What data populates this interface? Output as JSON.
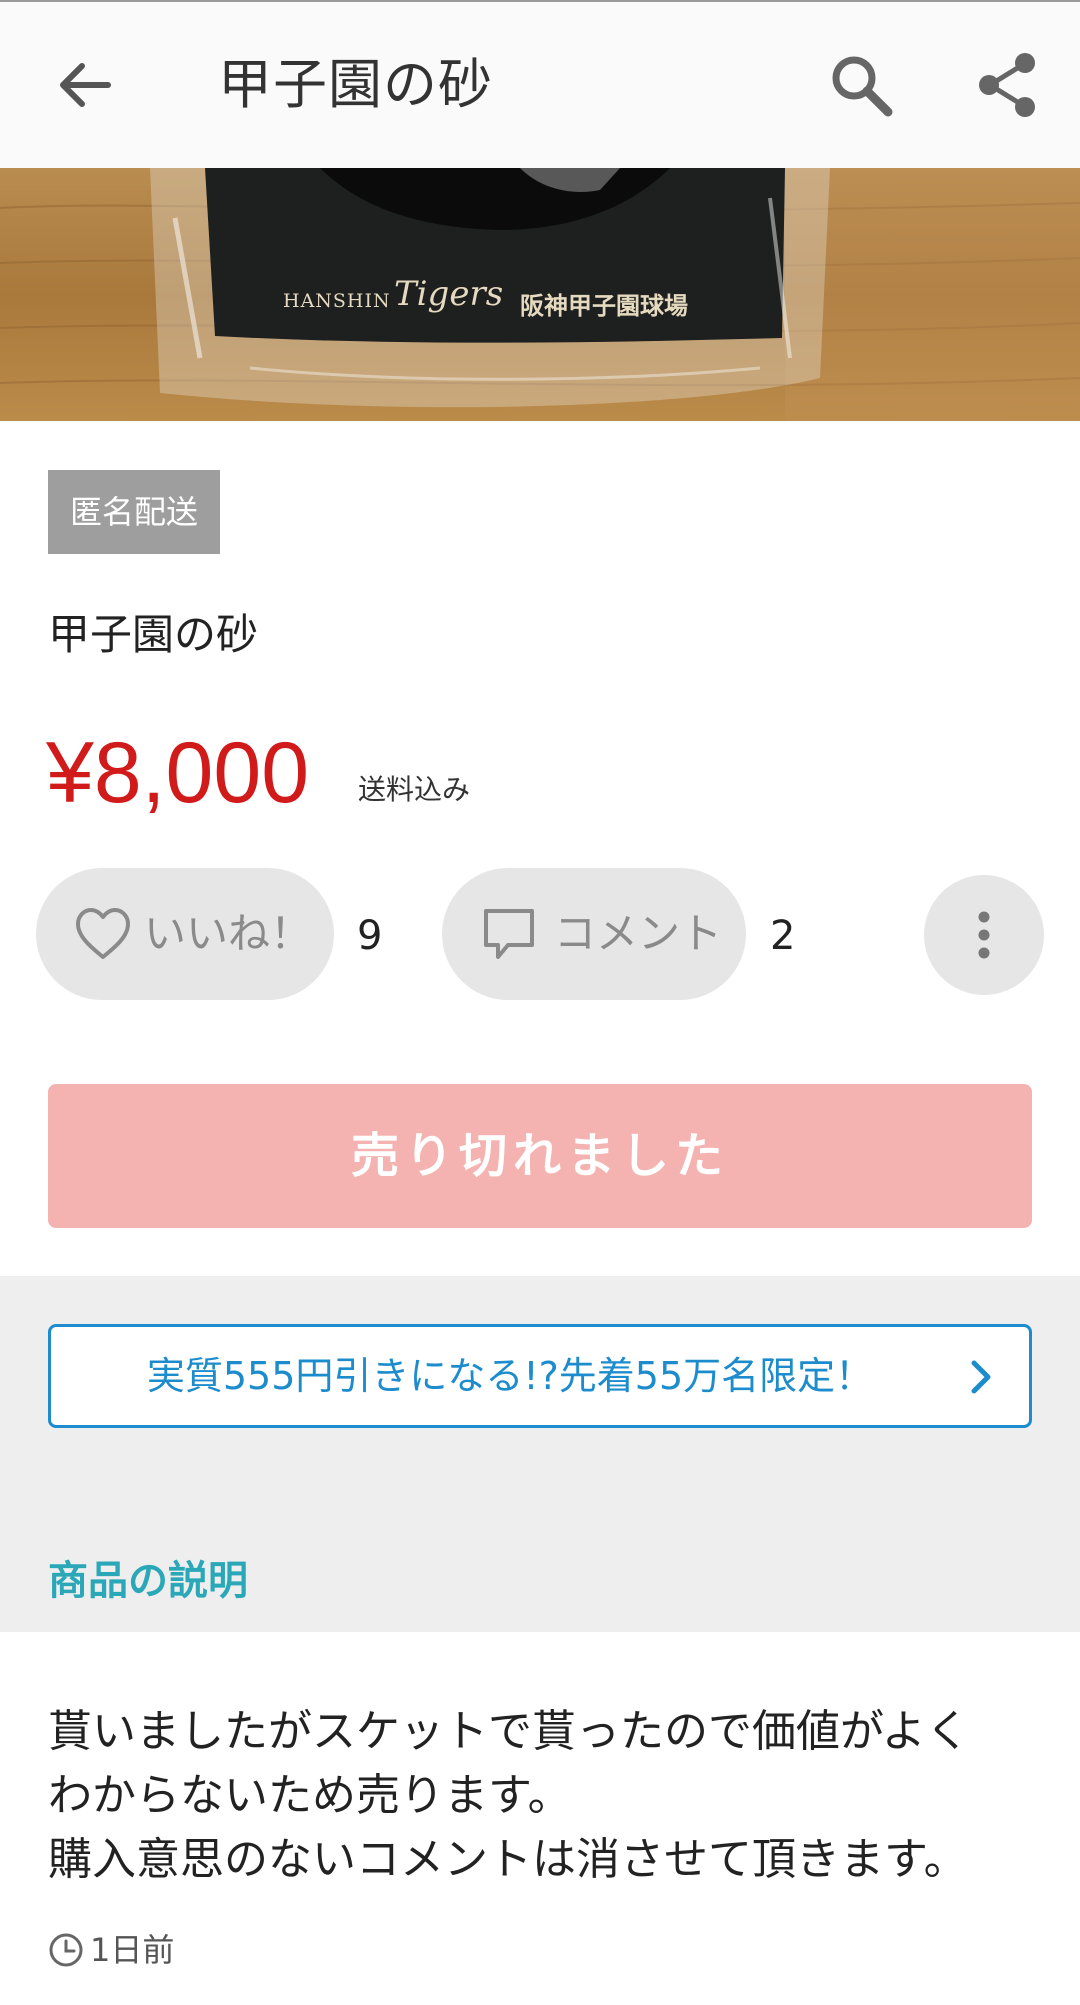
{
  "app_bar": {
    "title": "甲子園の砂",
    "back_icon": "arrow-left-icon",
    "search_icon": "search-icon",
    "share_icon": "share-icon"
  },
  "photo": {
    "brand_text": "HANSHIN",
    "brand_script": "Tigers",
    "stadium_text": "阪神甲子園球場"
  },
  "item": {
    "badge": "匿名配送",
    "name": "甲子園の砂",
    "price": "¥8,000",
    "shipping": "送料込み"
  },
  "actions": {
    "like_label": "いいね！",
    "like_count": "9",
    "comment_label": "コメント",
    "comment_count": "2",
    "more_icon": "more-vertical-icon"
  },
  "sold_out_label": "売り切れました",
  "promo": {
    "text": "実質555円引きになる!?先着55万名限定！"
  },
  "section": {
    "description_title": "商品の説明"
  },
  "description": {
    "lines": [
      "貰いましたがスケットで貰ったので価値がよく",
      "わからないため売ります。",
      "購入意思のないコメントは消させて頂きます。"
    ],
    "posted": "1日前"
  },
  "colors": {
    "price": "#d11a1a",
    "sold_out_button": "#f4b3b0",
    "promo_accent": "#1d8ccd",
    "section_title": "#2aa8b8",
    "badge_bg": "#9e9e9e"
  }
}
